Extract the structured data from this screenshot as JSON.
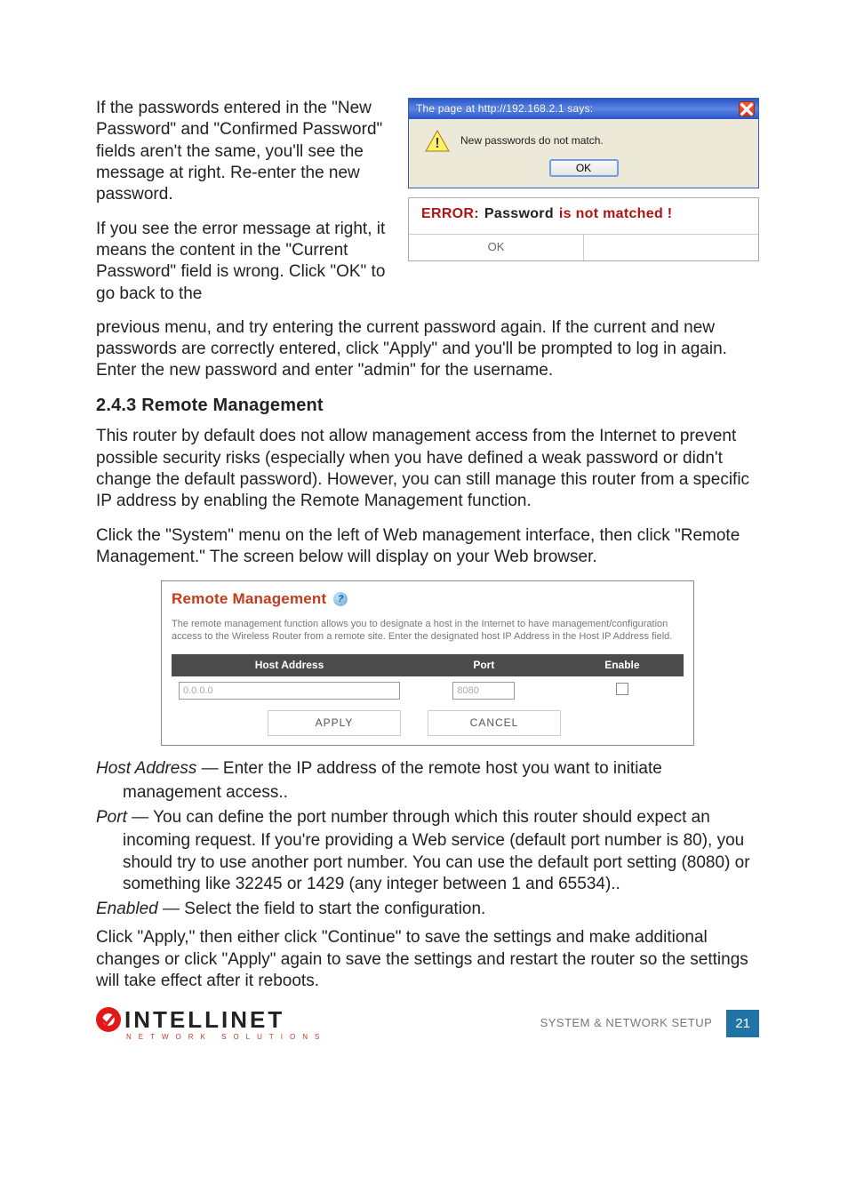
{
  "paras": {
    "p1a": "If the passwords entered in the \"New Password\" and \"Confirmed Password\" fields aren't the same, you'll see the message at right. Re-enter the new password.",
    "p2a": "If you see the error message at right, it means the content in the \"Current Password\" field is wrong. Click \"OK\" to go back to the",
    "p2b": "previous menu, and try entering the current password again. If the current and new passwords are correctly entered, click \"Apply\" and you'll be prompted to log in again. Enter the new password and enter \"admin\" for the username.",
    "p3": "This router by default does not allow management access from the Internet to prevent possible security risks (especially when you have defined a weak password or didn't change the default password). However, you can still manage this router from a specific IP address by enabling the Remote Management function.",
    "p4": "Click the \"System\" menu on the left of Web management interface, then click \"Remote Management.\" The screen below will display on your Web browser.",
    "p5": "Click \"Apply,\" then either click \"Continue\" to save the settings and make additional changes or click \"Apply\" again to save the settings and restart the router so the settings will take effect after it reboots."
  },
  "section_heading": "2.4.3  Remote Management",
  "alert": {
    "title": "The page at http://192.168.2.1 says:",
    "message": "New passwords do not match.",
    "ok": "OK"
  },
  "error": {
    "label_error": "ERROR:",
    "label_pwd": "Password",
    "label_rest": "is not matched !",
    "ok": "OK"
  },
  "panel": {
    "title": "Remote Management",
    "desc": "The remote management function allows you to designate a host in the Internet to have management/configuration access to the Wireless Router from a remote site. Enter the designated host IP Address in the Host IP Address field.",
    "cols": {
      "host": "Host Address",
      "port": "Port",
      "enable": "Enable"
    },
    "vals": {
      "host": "0.0.0.0",
      "port": "8080"
    },
    "buttons": {
      "apply": "APPLY",
      "cancel": "CANCEL"
    }
  },
  "defs": {
    "host_term": "Host Address",
    "host_body": " — Enter the IP address of the remote host you want to initiate management access..",
    "port_term": "Port",
    "port_body": " — You can define the port number through which this router should expect an incoming request. If you're providing a Web service (default port number is 80), you should try to use another port number. You can use the default port setting (8080) or something like 32245 or 1429 (any integer between 1 and 65534)..",
    "enabled_term": "Enabled",
    "enabled_body": " — Select the field to start the configuration."
  },
  "footer": {
    "brand": "INTELLINET",
    "sub": "NETWORK SOLUTIONS",
    "section": "SYSTEM & NETWORK SETUP",
    "page": "21"
  }
}
